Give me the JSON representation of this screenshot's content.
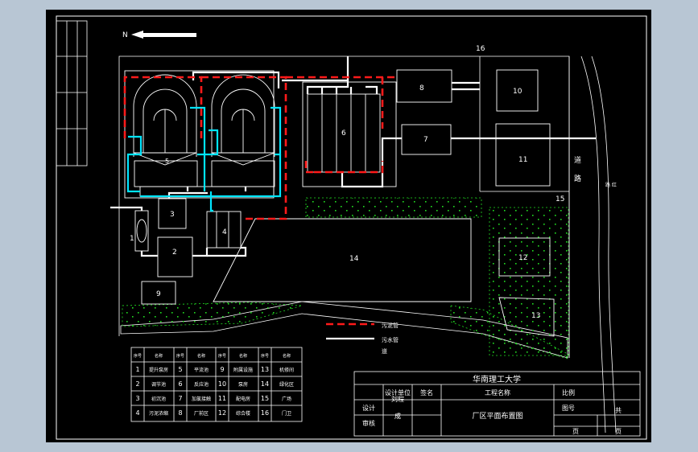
{
  "north": {
    "label": "N"
  },
  "margin": {
    "labels": [
      "",
      "",
      "",
      ""
    ]
  },
  "buildings": [
    "1",
    "2",
    "3",
    "4",
    "5",
    "6",
    "7",
    "8",
    "9",
    "10",
    "11",
    "12",
    "13",
    "14",
    "15",
    "16"
  ],
  "road": {
    "label_a": "道",
    "label_b": "路",
    "label_c": "路 红"
  },
  "legend": {
    "sludge": "污泥管",
    "water_a": "污水管",
    "water_b": "道"
  },
  "schedule": {
    "headers": [
      "序号",
      "名称",
      "序号",
      "名称",
      "序号",
      "名称",
      "序号",
      "名称"
    ],
    "nums": [
      "1",
      "2",
      "3",
      "4",
      "5",
      "6",
      "7",
      "8",
      "9",
      "10",
      "11",
      "12",
      "13",
      "14",
      "15",
      "16"
    ],
    "names": [
      "提升泵房",
      "调节池",
      "初沉池",
      "污泥浓缩",
      "平流池",
      "反应池",
      "加氯接触",
      "厂前区",
      "附属设施",
      "泵房",
      "配电房",
      "综合楼",
      "机修间",
      "绿化区",
      "广场",
      "门卫"
    ]
  },
  "title_block": {
    "university": "华南理工大学",
    "h_design_unit": "设计单位",
    "h_sign": "签名",
    "h_project": "工程名称",
    "h_scale": "比例",
    "r_design": "设计",
    "r_check": "审核",
    "name_a": "刘程",
    "name_b": "成",
    "drawing_title": "厂区平面布置图",
    "drawing_no": "图号",
    "total": "共",
    "page_a": "页",
    "page_b": "页"
  },
  "colors": {
    "sludge_pipe": "#ff1a1a",
    "return_pipe": "#00e5ff",
    "water_pipe": "#ffffff",
    "grass": "#22dd22",
    "sheet": "#000000"
  }
}
